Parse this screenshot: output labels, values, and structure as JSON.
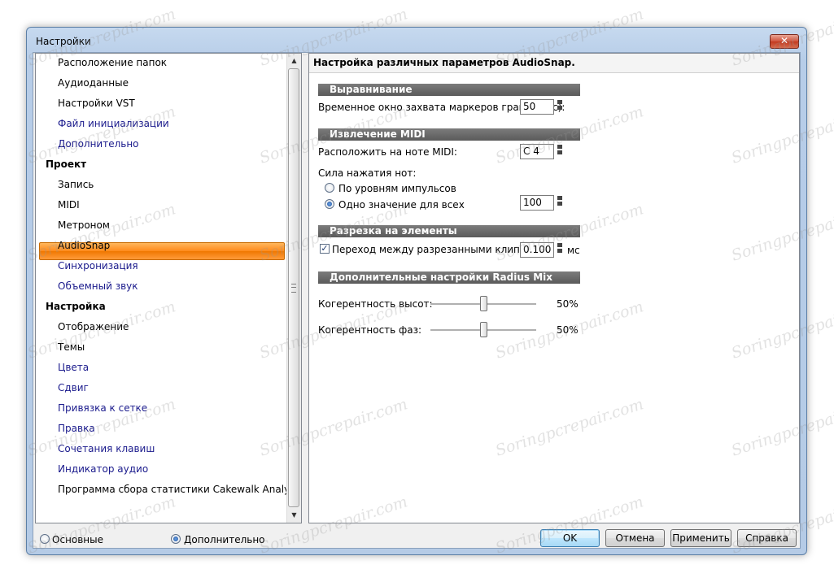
{
  "window": {
    "title": "Настройки",
    "close_glyph": "✕"
  },
  "sidebar": {
    "items": [
      {
        "label": "Расположение папок",
        "level": 1,
        "style": "plain"
      },
      {
        "label": "Аудиоданные",
        "level": 1,
        "style": "plain"
      },
      {
        "label": "Настройки VST",
        "level": 1,
        "style": "plain"
      },
      {
        "label": "Файл инициализации",
        "level": 1,
        "style": "link"
      },
      {
        "label": "Дополнительно",
        "level": 1,
        "style": "link"
      },
      {
        "label": "Проект",
        "level": 0,
        "style": "plain"
      },
      {
        "label": "Запись",
        "level": 1,
        "style": "plain"
      },
      {
        "label": "MIDI",
        "level": 1,
        "style": "plain"
      },
      {
        "label": "Метроном",
        "level": 1,
        "style": "plain"
      },
      {
        "label": "AudioSnap",
        "level": 1,
        "style": "plain",
        "selected": true
      },
      {
        "label": "Синхронизация",
        "level": 1,
        "style": "link"
      },
      {
        "label": "Объемный звук",
        "level": 1,
        "style": "link"
      },
      {
        "label": "Настройка",
        "level": 0,
        "style": "plain"
      },
      {
        "label": "Отображение",
        "level": 1,
        "style": "plain"
      },
      {
        "label": "Темы",
        "level": 1,
        "style": "plain"
      },
      {
        "label": "Цвета",
        "level": 1,
        "style": "link"
      },
      {
        "label": "Сдвиг",
        "level": 1,
        "style": "link"
      },
      {
        "label": "Привязка к сетке",
        "level": 1,
        "style": "link"
      },
      {
        "label": "Правка",
        "level": 1,
        "style": "link"
      },
      {
        "label": "Сочетания клавиш",
        "level": 1,
        "style": "link"
      },
      {
        "label": "Индикатор аудио",
        "level": 1,
        "style": "link"
      },
      {
        "label": "Программа сбора статистики Cakewalk Analytics",
        "level": 1,
        "style": "plain"
      }
    ],
    "scroll_up": "▲",
    "scroll_down": "▼"
  },
  "panel": {
    "header": "Настройка различных параметров AudioSnap.",
    "sections": {
      "alignment": "Выравнивание",
      "midi_extract": "Извлечение MIDI",
      "split": "Разрезка на элементы",
      "radius": "Дополнительные настройки Radius Mix"
    },
    "capture_window": {
      "label": "Временное окно захвата маркеров границ (мс):",
      "value": "50"
    },
    "midi_note": {
      "label": "Расположить на ноте MIDI:",
      "value": "C 4"
    },
    "velocity": {
      "label": "Сила нажатия нот:",
      "option_pulses": "По уровням импульсов",
      "option_single": "Одно значение для всех",
      "selected": "single",
      "value": "100"
    },
    "crossfade": {
      "checked": true,
      "check_glyph": "✓",
      "label": "Переход между разрезанными клипами",
      "value": "0.100",
      "unit": "мс"
    },
    "pitch_coherence": {
      "label": "Когерентность высот:",
      "value_text": "50%",
      "level": 0.5
    },
    "phase_coherence": {
      "label": "Когерентность фаз:",
      "value_text": "50%",
      "level": 0.5
    }
  },
  "footer": {
    "mode_basic": "Основные",
    "mode_advanced": "Дополнительно",
    "selected_mode": "advanced",
    "ok": "OK",
    "cancel": "Отмена",
    "apply": "Применить",
    "help": "Справка"
  },
  "watermark_text": "Soringpcrepair.com"
}
